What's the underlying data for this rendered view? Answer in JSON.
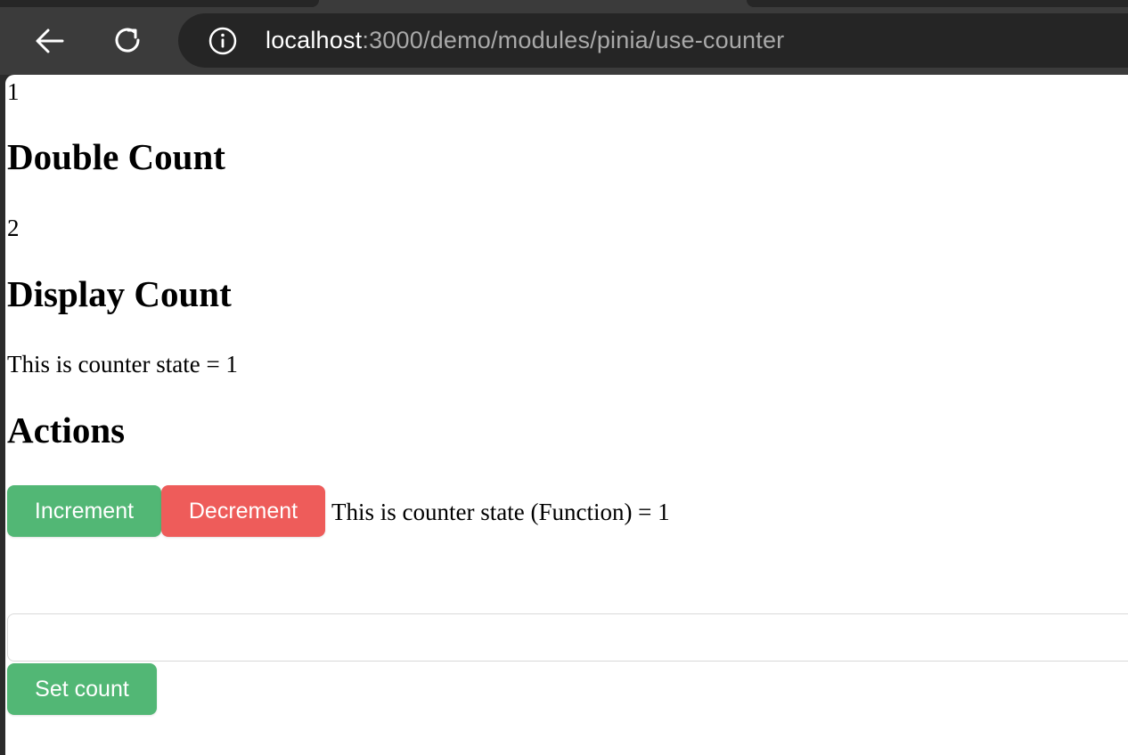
{
  "browser": {
    "url_host": "localhost",
    "url_path": ":3000/demo/modules/pinia/use-counter"
  },
  "page": {
    "count_value": "1",
    "double_count_heading": "Double Count",
    "double_count_value": "2",
    "display_count_heading": "Display Count",
    "display_count_text": "This is counter state = 1",
    "actions_heading": "Actions",
    "increment_label": "Increment",
    "decrement_label": "Decrement",
    "function_state_text": "This is counter state (Function) = 1",
    "count_input_value": "",
    "set_count_label": "Set count"
  },
  "colors": {
    "green_button": "#52b775",
    "red_button": "#ee5c5a"
  },
  "icons": {
    "back": "back-arrow-icon",
    "reload": "reload-icon",
    "info": "info-icon"
  }
}
